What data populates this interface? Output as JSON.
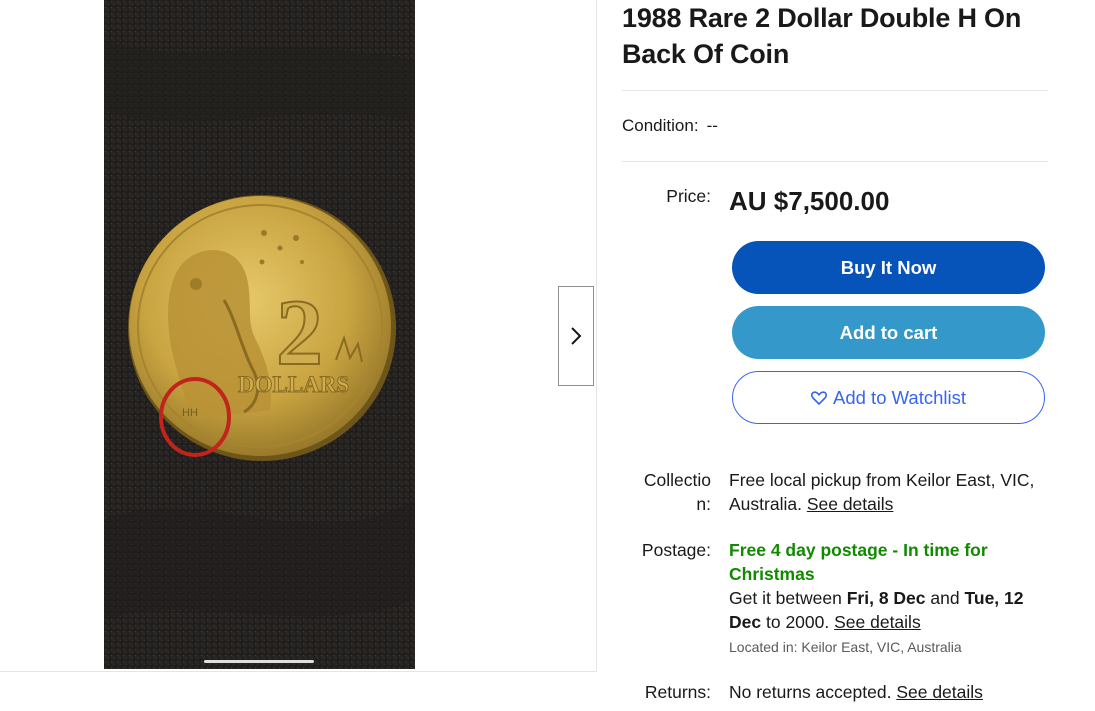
{
  "listing": {
    "title": "1988 Rare 2 Dollar Double H On Back Of Coin",
    "condition_label": "Condition:",
    "condition_value": "--",
    "price_label": "Price:",
    "price": "AU $7,500.00"
  },
  "gallery": {
    "coin_numeral": "2",
    "coin_text": "DOLLARS"
  },
  "buttons": {
    "buy_now": "Buy It Now",
    "add_to_cart": "Add to cart",
    "watchlist": "Add to Watchlist"
  },
  "collection": {
    "label_line1": "Collectio",
    "label_line2": "n:",
    "text": "Free local pickup from Keilor East, VIC, Australia.",
    "link": "See details"
  },
  "postage": {
    "label": "Postage:",
    "highlight": "Free 4 day postage - In time for Christmas",
    "delivery_prefix": "Get it between",
    "date_start": "Fri, 8 Dec",
    "delivery_and": "and",
    "date_end": "Tue, 12 Dec",
    "delivery_postcode": "to 2000.",
    "link": "See details",
    "location": "Located in: Keilor East, VIC, Australia"
  },
  "returns": {
    "label": "Returns:",
    "text": "No returns accepted.",
    "link": "See details"
  },
  "colors": {
    "buy_button": "#0654ba",
    "cart_button": "#3498ca",
    "watch_accent": "#3665f3",
    "green_text": "#118a00"
  }
}
